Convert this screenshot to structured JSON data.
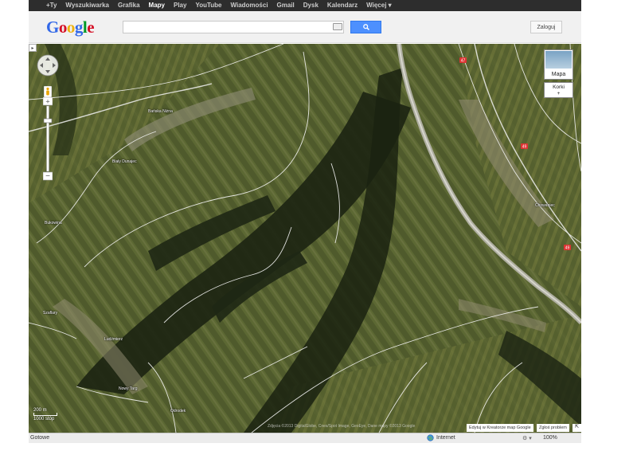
{
  "topnav": {
    "items": [
      "+Ty",
      "Wyszukiwarka",
      "Grafika",
      "Mapy",
      "Play",
      "YouTube",
      "Wiadomości",
      "Gmail",
      "Dysk",
      "Kalendarz",
      "Więcej ▾"
    ],
    "active_index": 3
  },
  "header": {
    "logo_letters": [
      "G",
      "o",
      "o",
      "g",
      "l",
      "e"
    ],
    "logo_colors": [
      "#3369e8",
      "#d50f25",
      "#eeb211",
      "#3369e8",
      "#009925",
      "#d50f25"
    ],
    "search_value": "",
    "search_icon": "search-icon",
    "login_label": "Zaloguj"
  },
  "map": {
    "view": "satellite",
    "maptype_label": "Mapa",
    "traffic_label": "Korki",
    "traffic_toggle": "+",
    "scale_top": "200 m",
    "scale_bottom": "1000 stóp",
    "copyright": "Zdjęcia ©2013 DigitalGlobe, Cnes/Spot Image, GeoEye, Dane mapy ©2013 Google",
    "edit_link": "Edytuj w Kreatorze map Google",
    "report_link": "Zgłoś problem",
    "expand_icon": "expand-icon",
    "roads": {
      "route_47": "47",
      "route_49": "49",
      "route_49b": "49"
    },
    "places": [
      "Biały Dunajec",
      "Bańska Niżna",
      "Chowaniec",
      "Bukowina",
      "Szaflary",
      "Ludźmierz",
      "Nowy Targ",
      "Odrodek"
    ]
  },
  "statusbar": {
    "status": "Gotowe",
    "zone": "Internet",
    "zoom": "100%"
  },
  "colors": {
    "topbar": "#2d2d2d",
    "search_button": "#4d90fe"
  }
}
